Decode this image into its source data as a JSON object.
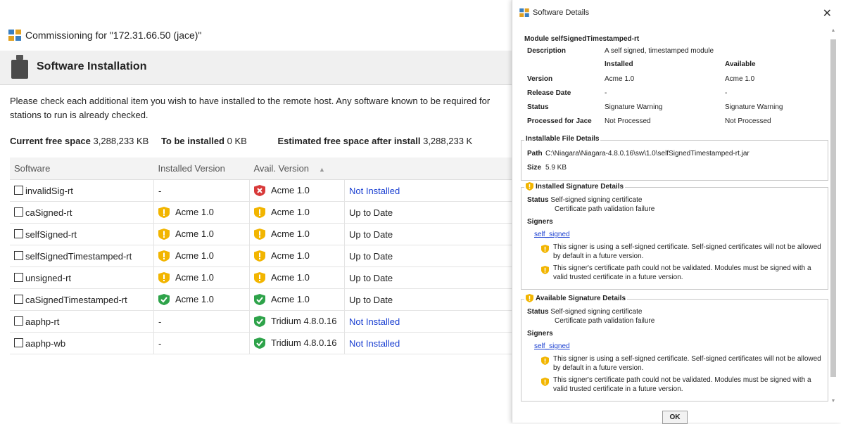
{
  "commissioning": {
    "title": "Commissioning for \"172.31.66.50 (jace)\"",
    "header_title": "Software Installation",
    "instructions": "Please check each additional item you wish to have installed to the remote host. Any software known to be required for stations to run is already checked.",
    "space": {
      "current_label": "Current free space",
      "current_value": "3,288,233 KB",
      "to_install_label": "To be installed",
      "to_install_value": "0 KB",
      "estimated_label": "Estimated free space after install",
      "estimated_value": "3,288,233 K"
    },
    "columns": [
      "Software",
      "Installed Version",
      "Avail. Version"
    ],
    "rows": [
      {
        "name": "invalidSig-rt",
        "installed": "-",
        "installed_icon": "",
        "avail": "Acme 1.0",
        "avail_icon": "error-shield-icon",
        "status": "Not Installed",
        "status_link": true
      },
      {
        "name": "caSigned-rt",
        "installed": "Acme 1.0",
        "installed_icon": "warning-shield-icon",
        "avail": "Acme 1.0",
        "avail_icon": "warning-shield-icon",
        "status": "Up to Date",
        "status_link": false
      },
      {
        "name": "selfSigned-rt",
        "installed": "Acme 1.0",
        "installed_icon": "warning-shield-icon",
        "avail": "Acme 1.0",
        "avail_icon": "warning-shield-icon",
        "status": "Up to Date",
        "status_link": false
      },
      {
        "name": "selfSignedTimestamped-rt",
        "installed": "Acme 1.0",
        "installed_icon": "warning-shield-icon",
        "avail": "Acme 1.0",
        "avail_icon": "warning-shield-icon",
        "status": "Up to Date",
        "status_link": false
      },
      {
        "name": "unsigned-rt",
        "installed": "Acme 1.0",
        "installed_icon": "warning-shield-icon",
        "avail": "Acme 1.0",
        "avail_icon": "warning-shield-icon",
        "status": "Up to Date",
        "status_link": false
      },
      {
        "name": "caSignedTimestamped-rt",
        "installed": "Acme 1.0",
        "installed_icon": "ok-shield-icon",
        "avail": "Acme 1.0",
        "avail_icon": "ok-shield-icon",
        "status": "Up to Date",
        "status_link": false
      },
      {
        "name": "aaphp-rt",
        "installed": "-",
        "installed_icon": "",
        "avail": "Tridium 4.8.0.16",
        "avail_icon": "ok-shield-icon",
        "status": "Not Installed",
        "status_link": true
      },
      {
        "name": "aaphp-wb",
        "installed": "-",
        "installed_icon": "",
        "avail": "Tridium 4.8.0.16",
        "avail_icon": "ok-shield-icon",
        "status": "Not Installed",
        "status_link": true
      }
    ]
  },
  "dialog": {
    "title": "Software Details",
    "close": "✕",
    "module_label": "Module selfSignedTimestamped-rt",
    "description_label": "Description",
    "description_value": "A self signed, timestamped module",
    "col_installed": "Installed",
    "col_available": "Available",
    "version_label": "Version",
    "version_installed": "Acme 1.0",
    "version_available": "Acme 1.0",
    "release_label": "Release Date",
    "release_installed": "-",
    "release_available": "-",
    "status_label": "Status",
    "status_installed": "Signature Warning",
    "status_available": "Signature Warning",
    "processed_label": "Processed for Jace",
    "processed_installed": "Not Processed",
    "processed_available": "Not Processed",
    "file_details_title": "Installable File Details",
    "path_label": "Path",
    "path_value": "C:\\Niagara\\Niagara-4.8.0.16\\sw\\1.0\\selfSignedTimestamped-rt.jar",
    "size_label": "Size",
    "size_value": "5.9 KB",
    "installed_sig": {
      "title": "Installed Signature Details",
      "status_label": "Status",
      "status_line1": "Self-signed signing certificate",
      "status_line2": "Certificate path validation failure",
      "signers_label": "Signers",
      "signer_link": "self_signed",
      "warning1": "This signer is using a self-signed certificate. Self-signed certificates will not be allowed by default in a future version.",
      "warning2": "This signer's certificate path could not be validated. Modules must be signed with a valid trusted certificate in a future version."
    },
    "available_sig": {
      "title": "Available Signature Details",
      "status_label": "Status",
      "status_line1": "Self-signed signing certificate",
      "status_line2": "Certificate path validation failure",
      "signers_label": "Signers",
      "signer_link": "self_signed",
      "warning1": "This signer is using a self-signed certificate. Self-signed certificates will not be allowed by default in a future version.",
      "warning2": "This signer's certificate path could not be validated. Modules must be signed with a valid trusted certificate in a future version."
    },
    "ok_label": "OK"
  },
  "colors": {
    "link": "#1a3fd1",
    "warning": "#f2b500",
    "error": "#d83a3a",
    "ok": "#2ea34a"
  }
}
